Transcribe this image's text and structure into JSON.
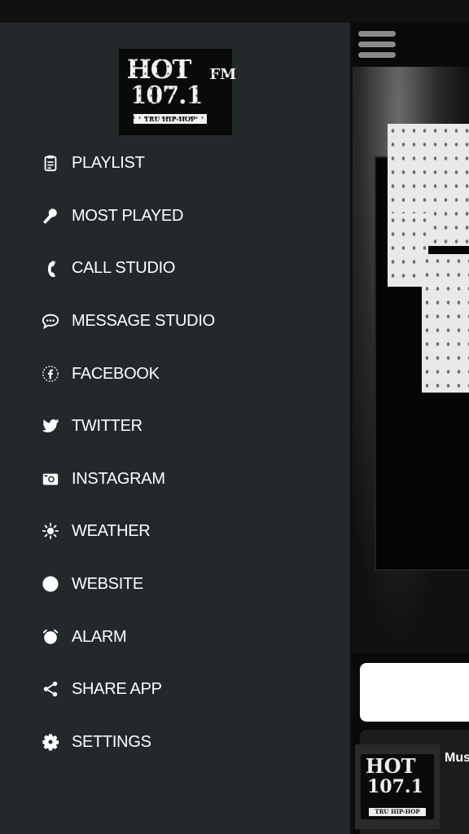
{
  "drawer": {
    "logo": {
      "line1": "HOT",
      "line2": "107.1",
      "side": "FM",
      "tagline": "TRU HIP-HOP"
    },
    "menu_items": [
      {
        "label": "PLAYLIST",
        "icon": "clipboard-icon"
      },
      {
        "label": "MOST PLAYED",
        "icon": "microphone-icon"
      },
      {
        "label": "CALL STUDIO",
        "icon": "phone-icon"
      },
      {
        "label": "MESSAGE STUDIO",
        "icon": "chat-bubble-icon"
      },
      {
        "label": "FACEBOOK",
        "icon": "facebook-icon"
      },
      {
        "label": "TWITTER",
        "icon": "twitter-icon"
      },
      {
        "label": "INSTAGRAM",
        "icon": "camera-icon"
      },
      {
        "label": "WEATHER",
        "icon": "sun-icon"
      },
      {
        "label": "WEBSITE",
        "icon": "globe-icon"
      },
      {
        "label": "ALARM",
        "icon": "alarm-clock-icon"
      },
      {
        "label": "SHARE APP",
        "icon": "share-icon"
      },
      {
        "label": "SETTINGS",
        "icon": "gear-icon"
      }
    ]
  },
  "main": {
    "now_playing_title": "Mus",
    "mini_logo": {
      "line1": "HOT",
      "line2": "107.1",
      "tagline": "TRU HIP-HOP"
    }
  },
  "colors": {
    "drawer_bg": "#23282b",
    "text": "#ffffff",
    "hamburger": "#8a8a8a"
  }
}
